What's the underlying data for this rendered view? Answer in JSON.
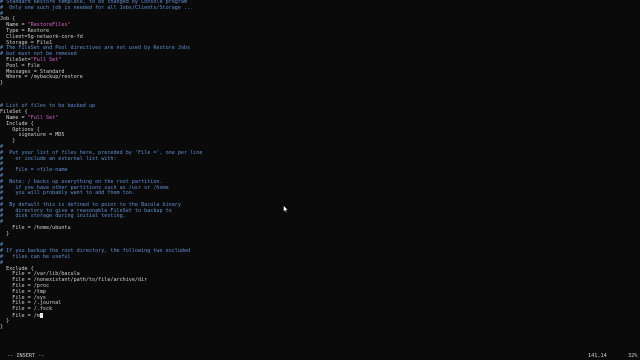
{
  "editor": {
    "lines": [
      {
        "segs": [
          {
            "c": "comment",
            "t": "# Standard Restore template, to be changed by Console program"
          }
        ]
      },
      {
        "segs": [
          {
            "c": "comment",
            "t": "#  Only one such job is needed for all Jobs/Clients/Storage ..."
          }
        ]
      },
      {
        "segs": [
          {
            "c": "comment",
            "t": "#"
          }
        ]
      },
      {
        "segs": [
          {
            "c": "normal",
            "t": "Job {"
          }
        ]
      },
      {
        "segs": [
          {
            "c": "normal",
            "t": "  Name = "
          },
          {
            "c": "str",
            "t": "\"RestoreFiles\""
          }
        ]
      },
      {
        "segs": [
          {
            "c": "normal",
            "t": "  Type = Restore"
          }
        ]
      },
      {
        "segs": [
          {
            "c": "normal",
            "t": "  Client=5g-network-core-fd"
          }
        ]
      },
      {
        "segs": [
          {
            "c": "normal",
            "t": "  Storage = File1"
          }
        ]
      },
      {
        "segs": [
          {
            "c": "comment",
            "t": "# The FileSet and Pool directives are not used by Restore Jobs"
          }
        ]
      },
      {
        "segs": [
          {
            "c": "comment",
            "t": "# but must not be removed"
          }
        ]
      },
      {
        "segs": [
          {
            "c": "normal",
            "t": "  FileSet="
          },
          {
            "c": "str",
            "t": "\"Full Set\""
          }
        ]
      },
      {
        "segs": [
          {
            "c": "normal",
            "t": "  Pool = File"
          }
        ]
      },
      {
        "segs": [
          {
            "c": "normal",
            "t": "  Messages = Standard"
          }
        ]
      },
      {
        "segs": [
          {
            "c": "normal",
            "t": "  Where = /mybackup/restore"
          }
        ]
      },
      {
        "segs": [
          {
            "c": "normal",
            "t": "}"
          }
        ]
      },
      {
        "segs": [
          {
            "c": "normal",
            "t": ""
          }
        ]
      },
      {
        "segs": [
          {
            "c": "normal",
            "t": ""
          }
        ]
      },
      {
        "segs": [
          {
            "c": "normal",
            "t": ""
          }
        ]
      },
      {
        "segs": [
          {
            "c": "comment",
            "t": "# List of files to be backed up"
          }
        ]
      },
      {
        "segs": [
          {
            "c": "normal",
            "t": "FileSet {"
          }
        ]
      },
      {
        "segs": [
          {
            "c": "normal",
            "t": "  Name = "
          },
          {
            "c": "str",
            "t": "\"Full Set\""
          }
        ]
      },
      {
        "segs": [
          {
            "c": "normal",
            "t": "  Include {"
          }
        ]
      },
      {
        "segs": [
          {
            "c": "normal",
            "t": "    Options {"
          }
        ]
      },
      {
        "segs": [
          {
            "c": "normal",
            "t": "      signature = MD5"
          }
        ]
      },
      {
        "segs": [
          {
            "c": "normal",
            "t": "    }"
          }
        ]
      },
      {
        "segs": [
          {
            "c": "comment",
            "t": "#"
          }
        ]
      },
      {
        "segs": [
          {
            "c": "comment",
            "t": "#  Put your list of files here, preceded by 'File =', one per line"
          }
        ]
      },
      {
        "segs": [
          {
            "c": "comment",
            "t": "#    or include an external list with:"
          }
        ]
      },
      {
        "segs": [
          {
            "c": "comment",
            "t": "#"
          }
        ]
      },
      {
        "segs": [
          {
            "c": "comment",
            "t": "#    File = "
          },
          {
            "c": "lt",
            "t": "<file-name"
          }
        ]
      },
      {
        "segs": [
          {
            "c": "comment",
            "t": "#"
          }
        ]
      },
      {
        "segs": [
          {
            "c": "comment",
            "t": "#  Note: / backs up everything on the root partition."
          }
        ]
      },
      {
        "segs": [
          {
            "c": "comment",
            "t": "#    if you have other partitions such as /usr or /home"
          }
        ]
      },
      {
        "segs": [
          {
            "c": "comment",
            "t": "#    you will probably want to add them too."
          }
        ]
      },
      {
        "segs": [
          {
            "c": "comment",
            "t": "#"
          }
        ]
      },
      {
        "segs": [
          {
            "c": "comment",
            "t": "#  By default this is defined to point to the Bacula binary"
          }
        ]
      },
      {
        "segs": [
          {
            "c": "comment",
            "t": "#    directory to give a reasonable FileSet to backup to"
          }
        ]
      },
      {
        "segs": [
          {
            "c": "comment",
            "t": "#    disk storage during initial testing."
          }
        ]
      },
      {
        "segs": [
          {
            "c": "comment",
            "t": "#"
          }
        ]
      },
      {
        "segs": [
          {
            "c": "normal",
            "t": "    File = /home/ubuntu"
          }
        ]
      },
      {
        "segs": [
          {
            "c": "normal",
            "t": "  }"
          }
        ]
      },
      {
        "segs": [
          {
            "c": "normal",
            "t": ""
          }
        ]
      },
      {
        "segs": [
          {
            "c": "comment",
            "t": "#"
          }
        ]
      },
      {
        "segs": [
          {
            "c": "comment",
            "t": "# If you backup the root directory, the following two excluded"
          }
        ]
      },
      {
        "segs": [
          {
            "c": "comment",
            "t": "#   files can be useful"
          }
        ]
      },
      {
        "segs": [
          {
            "c": "comment",
            "t": "#"
          }
        ]
      },
      {
        "segs": [
          {
            "c": "normal",
            "t": "  Exclude {"
          }
        ]
      },
      {
        "segs": [
          {
            "c": "normal",
            "t": "    File = /var/lib/bacula"
          }
        ]
      },
      {
        "segs": [
          {
            "c": "normal",
            "t": "    File = /nonexistant/path/to/file/archive/dir"
          }
        ]
      },
      {
        "segs": [
          {
            "c": "normal",
            "t": "    File = /proc"
          }
        ]
      },
      {
        "segs": [
          {
            "c": "normal",
            "t": "    File = /tmp"
          }
        ]
      },
      {
        "segs": [
          {
            "c": "normal",
            "t": "    File = /sys"
          }
        ]
      },
      {
        "segs": [
          {
            "c": "normal",
            "t": "    File = /.journal"
          }
        ]
      },
      {
        "segs": [
          {
            "c": "normal",
            "t": "    File = /.fsck"
          }
        ]
      },
      {
        "segs": [
          {
            "c": "normal",
            "t": "    File = /m"
          }
        ],
        "cursor": true
      },
      {
        "segs": [
          {
            "c": "normal",
            "t": "  }"
          }
        ]
      },
      {
        "segs": [
          {
            "c": "normal",
            "t": "}"
          }
        ]
      }
    ]
  },
  "statusbar": {
    "mode": "-- INSERT --",
    "position": "141,14",
    "scroll": "32%"
  },
  "colors": {
    "background": "#0a0a0a",
    "comment": "#5f8fd0",
    "string": "#e060d0",
    "text": "#d0d0d0"
  }
}
